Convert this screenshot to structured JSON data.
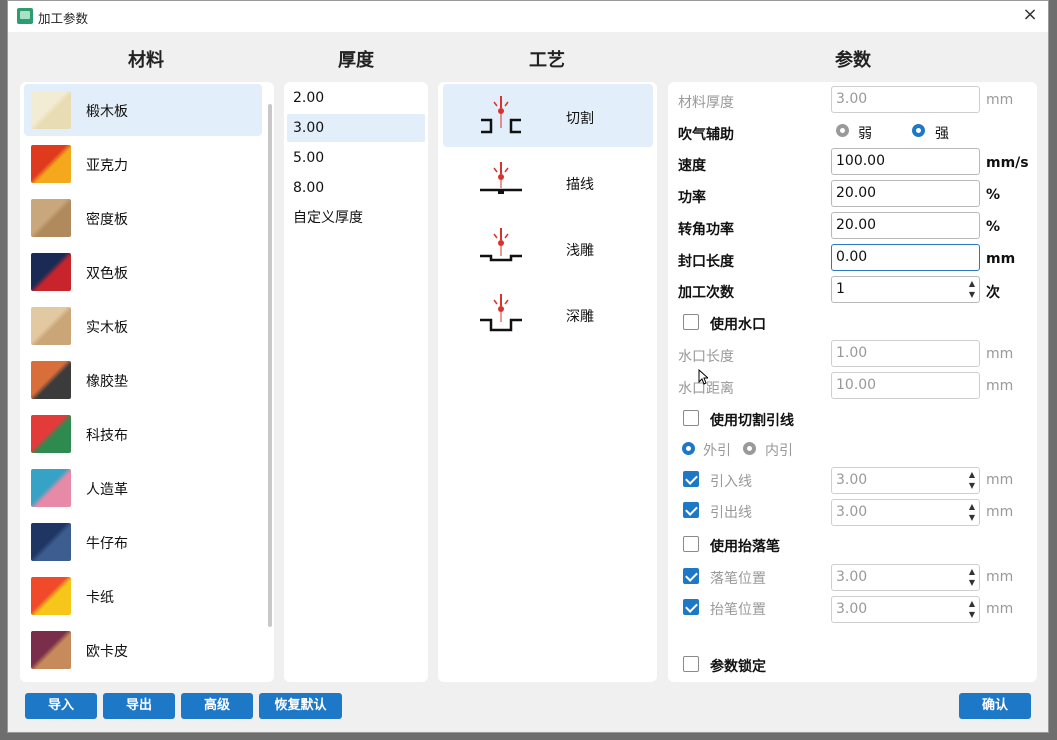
{
  "window": {
    "title": "加工参数",
    "close_glyph": "×"
  },
  "headers": {
    "material": "材料",
    "thickness": "厚度",
    "process": "工艺",
    "params": "参数"
  },
  "materials": [
    {
      "label": "椴木板",
      "selected": true,
      "colors": [
        "#f3ecd5",
        "#e8dcb4"
      ]
    },
    {
      "label": "亚克力",
      "selected": false,
      "colors": [
        "#e03a1e",
        "#f4a81c"
      ]
    },
    {
      "label": "密度板",
      "selected": false,
      "colors": [
        "#c9a77c",
        "#b08a5d"
      ]
    },
    {
      "label": "双色板",
      "selected": false,
      "colors": [
        "#1b2a55",
        "#c8242c"
      ]
    },
    {
      "label": "实木板",
      "selected": false,
      "colors": [
        "#e3c9a2",
        "#caa577"
      ]
    },
    {
      "label": "橡胶垫",
      "selected": false,
      "colors": [
        "#d96e3a",
        "#3b3b3b"
      ]
    },
    {
      "label": "科技布",
      "selected": false,
      "colors": [
        "#e33a3a",
        "#2f8a4f"
      ]
    },
    {
      "label": "人造革",
      "selected": false,
      "colors": [
        "#36a3c6",
        "#e68aa7"
      ]
    },
    {
      "label": "牛仔布",
      "selected": false,
      "colors": [
        "#1f3564",
        "#3d5c8f"
      ]
    },
    {
      "label": "卡纸",
      "selected": false,
      "colors": [
        "#f04a2a",
        "#f7c61a"
      ]
    },
    {
      "label": "欧卡皮",
      "selected": false,
      "colors": [
        "#7a2e4a",
        "#c78a5a"
      ]
    }
  ],
  "thickness": [
    {
      "label": "2.00",
      "selected": false
    },
    {
      "label": "3.00",
      "selected": true
    },
    {
      "label": "5.00",
      "selected": false
    },
    {
      "label": "8.00",
      "selected": false
    },
    {
      "label": "自定义厚度",
      "selected": false
    }
  ],
  "processes": [
    {
      "label": "切割",
      "icon": "cut-icon",
      "selected": true
    },
    {
      "label": "描线",
      "icon": "trace-icon",
      "selected": false
    },
    {
      "label": "浅雕",
      "icon": "shallow-engrave-icon",
      "selected": false
    },
    {
      "label": "深雕",
      "icon": "deep-engrave-icon",
      "selected": false
    }
  ],
  "params": {
    "material_thickness": {
      "label": "材料厚度",
      "value": "3.00",
      "unit": "mm"
    },
    "air_assist": {
      "label": "吹气辅助",
      "weak": "弱",
      "strong": "强",
      "selected": "strong"
    },
    "speed": {
      "label": "速度",
      "value": "100.00",
      "unit": "mm/s"
    },
    "power": {
      "label": "功率",
      "value": "20.00",
      "unit": "%"
    },
    "corner_power": {
      "label": "转角功率",
      "value": "20.00",
      "unit": "%"
    },
    "seal_length": {
      "label": "封口长度",
      "value": "0.00",
      "unit": "mm"
    },
    "passes": {
      "label": "加工次数",
      "value": "1",
      "unit": "次"
    },
    "use_tab": {
      "label": "使用水口",
      "checked": false
    },
    "tab_length": {
      "label": "水口长度",
      "value": "1.00",
      "unit": "mm"
    },
    "tab_distance": {
      "label": "水口距离",
      "value": "10.00",
      "unit": "mm"
    },
    "use_leadin": {
      "label": "使用切割引线",
      "checked": false
    },
    "lead_outer": "外引",
    "lead_inner": "内引",
    "lead_in": {
      "label": "引入线",
      "value": "3.00",
      "unit": "mm",
      "checked": true
    },
    "lead_out": {
      "label": "引出线",
      "value": "3.00",
      "unit": "mm",
      "checked": true
    },
    "use_pen": {
      "label": "使用抬落笔",
      "checked": false
    },
    "pen_down": {
      "label": "落笔位置",
      "value": "3.00",
      "unit": "mm",
      "checked": true
    },
    "pen_up": {
      "label": "抬笔位置",
      "value": "3.00",
      "unit": "mm",
      "checked": true
    },
    "lock": {
      "label": "参数锁定",
      "checked": false
    }
  },
  "buttons": {
    "import": "导入",
    "export": "导出",
    "advanced": "高级",
    "restore": "恢复默认",
    "confirm": "确认"
  },
  "colors": {
    "accent": "#1e78c8",
    "selection": "#e2eef9",
    "laser": "#d8322a"
  }
}
